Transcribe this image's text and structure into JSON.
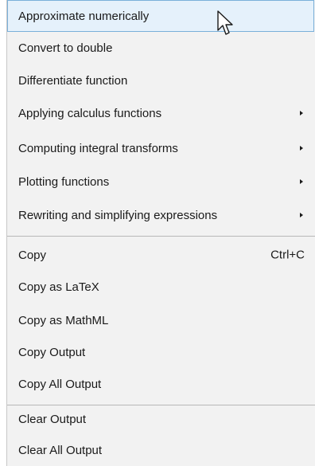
{
  "menu": {
    "items": [
      {
        "label": "Approximate numerically"
      },
      {
        "label": "Convert to double"
      },
      {
        "label": "Differentiate function"
      },
      {
        "label": "Applying calculus functions"
      },
      {
        "label": "Computing integral transforms"
      },
      {
        "label": "Plotting functions"
      },
      {
        "label": "Rewriting and simplifying expressions"
      },
      {
        "label": "Copy",
        "shortcut": "Ctrl+C"
      },
      {
        "label": "Copy as LaTeX"
      },
      {
        "label": "Copy as MathML"
      },
      {
        "label": "Copy Output"
      },
      {
        "label": "Copy All Output"
      },
      {
        "label": "Clear Output"
      },
      {
        "label": "Clear All Output"
      }
    ]
  },
  "colors": {
    "menu_background": "#f2f2f2",
    "highlight_background": "#e5f1fb",
    "highlight_border": "#7ab0da",
    "separator": "#b8b8b8"
  },
  "icons": {
    "submenu": "triangle-right-icon",
    "cursor": "mouse-pointer-icon"
  }
}
